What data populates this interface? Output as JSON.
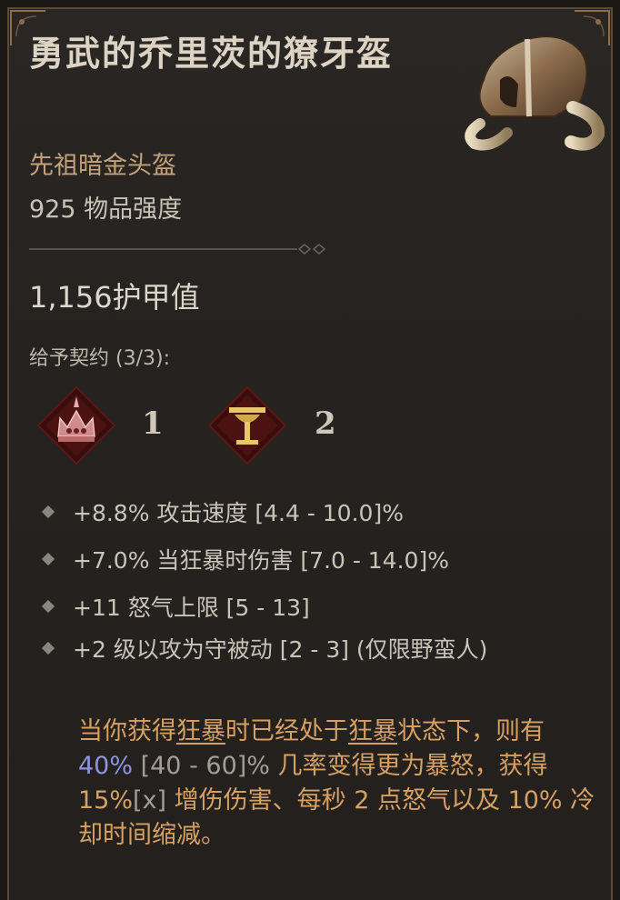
{
  "item": {
    "name": "勇武的乔里茨的獠牙盔",
    "type": "先祖暗金头盔",
    "power": "925 物品强度",
    "armor": "1,156护甲值"
  },
  "pact": {
    "label": "给予契约 (3/3):",
    "icons": [
      {
        "icon": "ferocity-crown-icon",
        "count": "1"
      },
      {
        "icon": "divinity-chalice-icon",
        "count": "2"
      }
    ]
  },
  "affixes": [
    {
      "text": "+8.8% 攻击速度 [4.4 - 10.0]%"
    },
    {
      "text": "+7.0% 当狂暴时伤害 [7.0 - 14.0]%"
    },
    {
      "text": "+11 怒气上限 [5 - 13]"
    },
    {
      "text": "+2 级以攻为守被动 [2 - 3] (仅限野蛮人)"
    }
  ],
  "aspect": {
    "p1": "当你获得",
    "berserk1": "狂暴",
    "p2": "时已经处于",
    "berserk2": "狂暴",
    "p3": "状态下，则有 ",
    "chance": "40%",
    "range": " [40 - 60]% ",
    "p4": "几率变得更为暴怒，获得 15%",
    "x": "[x]",
    "p5": " 增伤伤害、每秒 2 点怒气以及 10% 冷却时间缩减。"
  },
  "colors": {
    "accent_gold": "#d7a063",
    "legendary_text": "#c4a27a",
    "highlight_blue": "#8f93e0"
  }
}
